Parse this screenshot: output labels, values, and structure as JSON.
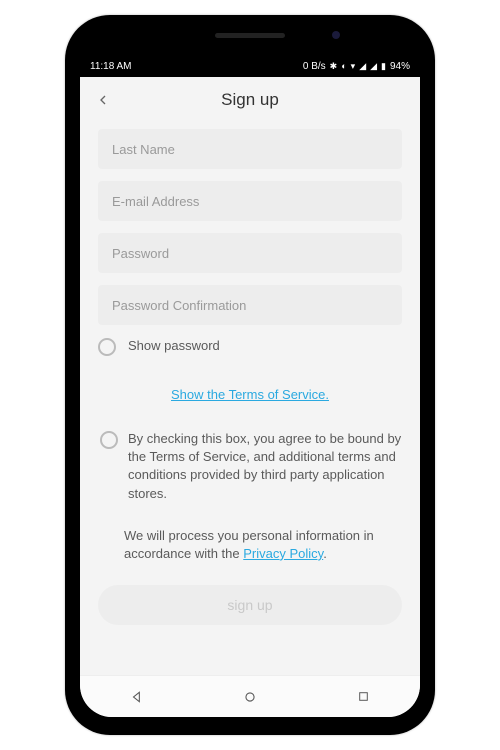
{
  "statusbar": {
    "time": "11:18 AM",
    "net_speed": "0 B/s",
    "battery_pct": "94%"
  },
  "appbar": {
    "title": "Sign up"
  },
  "fields": {
    "last_name_placeholder": "Last Name",
    "email_placeholder": "E-mail Address",
    "password_placeholder": "Password",
    "password_confirm_placeholder": "Password Confirmation"
  },
  "show_password_label": "Show password",
  "tos_link_text": "Show the Terms of Service.",
  "agree_text": "By checking this box, you agree to be bound by the Terms of Service, and additional terms and conditions provided by third party application stores.",
  "privacy_prefix": "We will process you personal information in accordance with the ",
  "privacy_link": "Privacy Policy",
  "privacy_suffix": ".",
  "signup_button": "sign up"
}
